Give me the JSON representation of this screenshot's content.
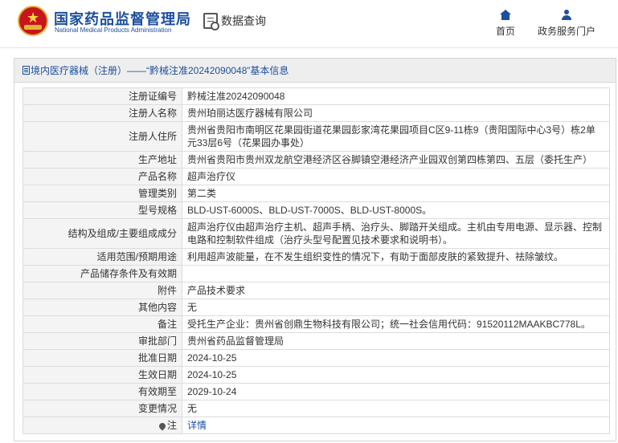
{
  "header": {
    "site_title_cn": "国家药品监督管理局",
    "site_title_en": "National Medical Products Administration",
    "query_label": "数据查询",
    "nav": [
      {
        "label": "首页",
        "icon": "home-icon"
      },
      {
        "label": "政务服务门户",
        "icon": "user-icon"
      }
    ]
  },
  "panel": {
    "title": "境内医疗器械（注册）——“黔械注准20242090048”基本信息"
  },
  "rows": [
    {
      "key": "注册证编号",
      "value": "黔械注准20242090048"
    },
    {
      "key": "注册人名称",
      "value": "贵州珀丽达医疗器械有限公司"
    },
    {
      "key": "注册人住所",
      "value": "贵州省贵阳市南明区花果园街道花果园彭家湾花果园项目C区9-11栋9（贵阳国际中心3号）栋2单元33层6号（花果园办事处）"
    },
    {
      "key": "生产地址",
      "value": "贵州省贵阳市贵州双龙航空港经济区谷脚镇空港经济产业园双创第四栋第四、五层（委托生产）"
    },
    {
      "key": "产品名称",
      "value": "超声治疗仪"
    },
    {
      "key": "管理类别",
      "value": "第二类"
    },
    {
      "key": "型号规格",
      "value": "BLD-UST-6000S、BLD-UST-7000S、BLD-UST-8000S。"
    },
    {
      "key": "结构及组成/主要组成成分",
      "value": "超声治疗仪由超声治疗主机、超声手柄、治疗头、脚踏开关组成。主机由专用电源、显示器、控制电路和控制软件组成（治疗头型号配置见技术要求和说明书）。"
    },
    {
      "key": "适用范围/预期用途",
      "value": "利用超声波能量，在不发生组织变性的情况下，有助于面部皮肤的紧致提升、祛除皱纹。"
    },
    {
      "key": "产品储存条件及有效期",
      "value": ""
    },
    {
      "key": "附件",
      "value": "产品技术要求"
    },
    {
      "key": "其他内容",
      "value": "无"
    },
    {
      "key": "备注",
      "value": "受托生产企业：贵州省创鼎生物科技有限公司；统一社会信用代码：91520112MAAKBC778L。"
    },
    {
      "key": "审批部门",
      "value": "贵州省药品监督管理局"
    },
    {
      "key": "批准日期",
      "value": "2024-10-25"
    },
    {
      "key": "生效日期",
      "value": "2024-10-25"
    },
    {
      "key": "有效期至",
      "value": "2029-10-24"
    },
    {
      "key": "变更情况",
      "value": "无"
    }
  ],
  "note_row": {
    "key": "注",
    "link": "详情"
  }
}
